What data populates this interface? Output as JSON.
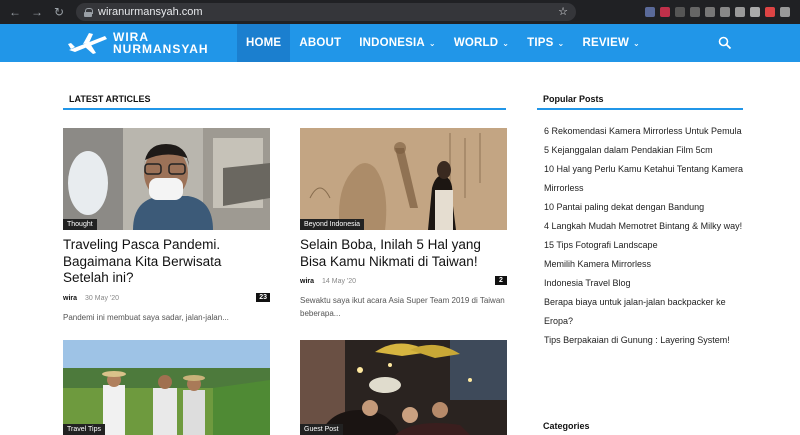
{
  "browser": {
    "url": "wiranurmansyah.com"
  },
  "site": {
    "logo_line1": "WIRA",
    "logo_line2": "NURMANSYAH",
    "menu": [
      {
        "label": "HOME",
        "active": true,
        "dropdown": false
      },
      {
        "label": "ABOUT",
        "active": false,
        "dropdown": false
      },
      {
        "label": "INDONESIA",
        "active": false,
        "dropdown": true
      },
      {
        "label": "WORLD",
        "active": false,
        "dropdown": true
      },
      {
        "label": "TIPS",
        "active": false,
        "dropdown": true
      },
      {
        "label": "REVIEW",
        "active": false,
        "dropdown": true
      }
    ],
    "colors": {
      "header": "#2196e8",
      "active_menu": "#1b7fcf",
      "accent_line": "#2196e8"
    }
  },
  "latest": {
    "title": "LATEST ARTICLES",
    "articles": [
      {
        "category": "Thought",
        "title": "Traveling Pasca Pandemi. Bagaimana Kita Berwisata Setelah ini?",
        "author": "wira",
        "date": "30 May '20",
        "comments": "23",
        "excerpt": "Pandemi ini membuat saya sadar, jalan-jalan..."
      },
      {
        "category": "Beyond Indonesia",
        "title": "Selain Boba, Inilah 5 Hal yang Bisa Kamu Nikmati di Taiwan!",
        "author": "wira",
        "date": "14 May '20",
        "comments": "2",
        "excerpt": "Sewaktu saya ikut acara Asia Super Team 2019 di Taiwan beberapa..."
      },
      {
        "category": "Travel Tips",
        "title": "",
        "author": "",
        "date": "",
        "comments": "",
        "excerpt": ""
      },
      {
        "category": "Guest Post",
        "title": "",
        "author": "",
        "date": "",
        "comments": "",
        "excerpt": ""
      }
    ]
  },
  "popular": {
    "title": "Popular Posts",
    "items": [
      "6 Rekomendasi Kamera Mirrorless Untuk Pemula",
      "5 Kejanggalan dalam Pendakian Film 5cm",
      "10 Hal yang Perlu Kamu Ketahui Tentang Kamera Mirrorless",
      "10 Pantai paling dekat dengan Bandung",
      "4 Langkah Mudah Memotret Bintang & Milky way!",
      "15 Tips Fotografi Landscape",
      "Memilih Kamera Mirrorless",
      "Indonesia Travel Blog",
      "Berapa biaya untuk jalan-jalan backpacker ke Eropa?",
      "Tips Berpakaian di Gunung : Layering System!"
    ]
  },
  "categories": {
    "title": "Categories"
  }
}
